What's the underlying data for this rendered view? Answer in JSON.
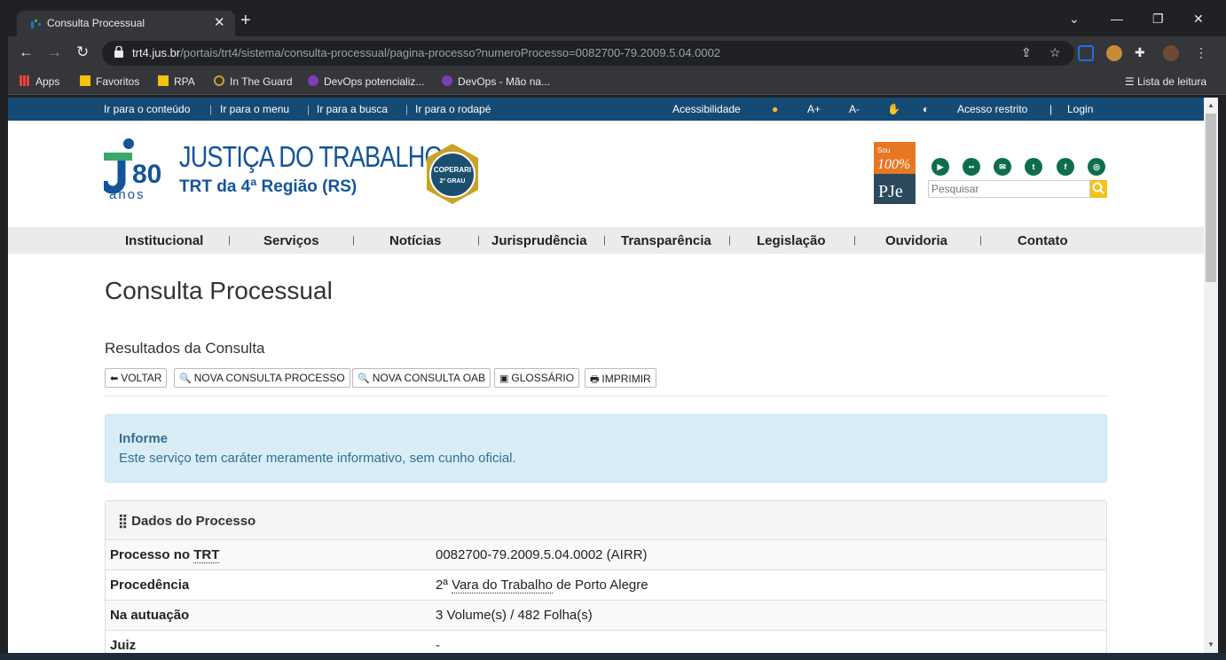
{
  "browser": {
    "tab_title": "Consulta Processual",
    "tab_close": "✕",
    "new_tab": "+",
    "url_host": "trt4.jus.br",
    "url_path": "/portais/trt4/sistema/consulta-processual/pagina-processo?numeroProcesso=0082700-79.2009.5.04.0002",
    "bookmarks": [
      "Apps",
      "Favoritos",
      "RPA",
      "In The Guard",
      "DevOps potencializ...",
      "DevOps - Mão na..."
    ],
    "reading_list": "Lista de leitura"
  },
  "accessbar": {
    "links": [
      "Ir para o conteúdo",
      "Ir para o menu",
      "Ir para a busca",
      "Ir para o rodapé"
    ],
    "accessibility": "Acessibilidade",
    "font_up": "A+",
    "font_down": "A-",
    "restricted": "Acesso restrito",
    "login": "Login"
  },
  "header": {
    "logo_number": "80",
    "logo_anos": "anos",
    "title": "JUSTIÇA DO TRABALHO",
    "subtitle": "TRT da 4ª Região (RS)",
    "badge_text_top": "COPERARI",
    "badge_text_bottom": "2º GRAU",
    "pje_sou": "Sou",
    "pje_100": "100%",
    "pje_label": "PJe",
    "search_placeholder": "Pesquisar"
  },
  "menu": [
    "Institucional",
    "Serviços",
    "Notícias",
    "Jurisprudência",
    "Transparência",
    "Legislação",
    "Ouvidoria",
    "Contato"
  ],
  "content": {
    "page_title": "Consulta Processual",
    "results_title": "Resultados da Consulta",
    "buttons": [
      "VOLTAR",
      "NOVA CONSULTA PROCESSO",
      "NOVA CONSULTA OAB",
      "GLOSSÁRIO",
      "IMPRIMIR"
    ],
    "alert_title": "Informe",
    "alert_text": "Este serviço tem caráter meramente informativo, sem cunho oficial.",
    "panel_title": "Dados do Processo",
    "rows": [
      {
        "label_pre": "Processo no ",
        "label_abbr": "TRT",
        "value_pre": "0082700-79.2009.5.04.0002 (AIRR)",
        "value_abbr": "",
        "value_post": ""
      },
      {
        "label_pre": "Procedência",
        "label_abbr": "",
        "value_pre": "2ª ",
        "value_abbr": "Vara do Trabalho",
        "value_post": " de Porto Alegre"
      },
      {
        "label_pre": "Na autuação",
        "label_abbr": "",
        "value_pre": "3 Volume(s) / 482 Folha(s)",
        "value_abbr": "",
        "value_post": ""
      },
      {
        "label_pre": "",
        "label_abbr": "Juiz",
        "value_pre": "-",
        "value_abbr": "",
        "value_post": ""
      }
    ]
  },
  "colors": {
    "accessbar_bg": "#154a75",
    "brand_blue": "#15539b",
    "alert_bg": "#d9edf7",
    "alert_text": "#31708f",
    "social_green": "#0e6d4f"
  }
}
